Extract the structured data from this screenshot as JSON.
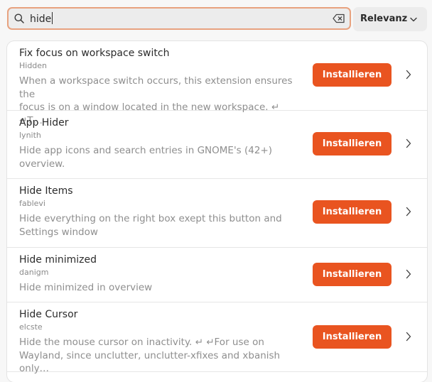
{
  "search": {
    "value": "hide",
    "clear_icon": "backspace-clear-icon",
    "search_icon": "search-icon"
  },
  "sort": {
    "label": "Relevanz",
    "chevron_icon": "chevron-down-icon"
  },
  "extensions": [
    {
      "title": "Fix focus on workspace switch",
      "author": "Hidden",
      "desc_line1": "When a workspace switch occurs, this extension ensures the",
      "desc_line2": "focus is on a window located in the new workspace. ↵ ↵T…",
      "button": "Installieren"
    },
    {
      "title": "App Hider",
      "author": "lynith",
      "desc_line1": "Hide app icons and search entries in GNOME's (42+)",
      "desc_line2": "overview.",
      "button": "Installieren"
    },
    {
      "title": "Hide Items",
      "author": "fablevi",
      "desc_line1": "Hide everything on the right box exept this button and",
      "desc_line2": "Settings window",
      "button": "Installieren"
    },
    {
      "title": "Hide minimized",
      "author": "danigm",
      "desc_line1": "Hide minimized in overview",
      "desc_line2": "",
      "button": "Installieren"
    },
    {
      "title": "Hide Cursor",
      "author": "elcste",
      "desc_line1": "Hide the mouse cursor on inactivity. ↵ ↵For use on",
      "desc_line2": "Wayland, since unclutter, unclutter-xfixes and xbanish only…",
      "button": "Installieren"
    }
  ],
  "colors": {
    "accent": "#e95420",
    "search_border": "#e8a27f"
  }
}
